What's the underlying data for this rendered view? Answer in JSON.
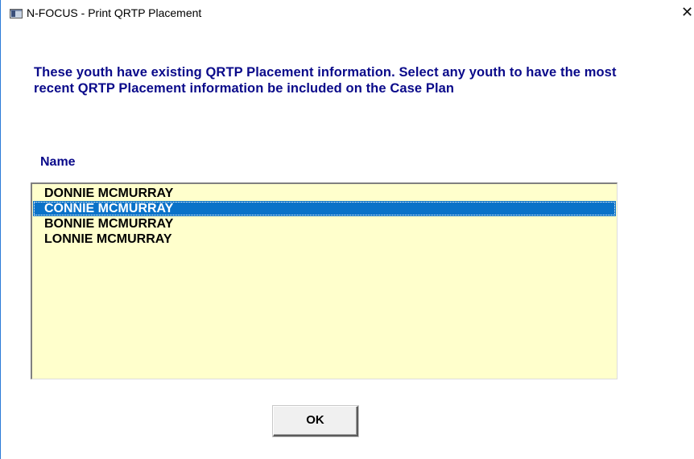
{
  "window": {
    "title": "N-FOCUS - Print QRTP Placement",
    "close_glyph": "✕",
    "app_icon": "window-app-icon"
  },
  "dialog": {
    "message": "These youth have existing QRTP Placement information. Select any youth to have the most recent QRTP Placement information be included on the Case Plan",
    "list_header": "Name",
    "items": [
      {
        "label": "DONNIE MCMURRAY",
        "selected": false
      },
      {
        "label": "CONNIE MCMURRAY",
        "selected": true
      },
      {
        "label": "BONNIE MCMURRAY",
        "selected": false
      },
      {
        "label": "LONNIE MCMURRAY",
        "selected": false
      }
    ],
    "ok_label": "OK"
  },
  "colors": {
    "text_accent": "#0a0a8a",
    "list_background": "#ffffcc",
    "selection": "#0a72c8"
  }
}
